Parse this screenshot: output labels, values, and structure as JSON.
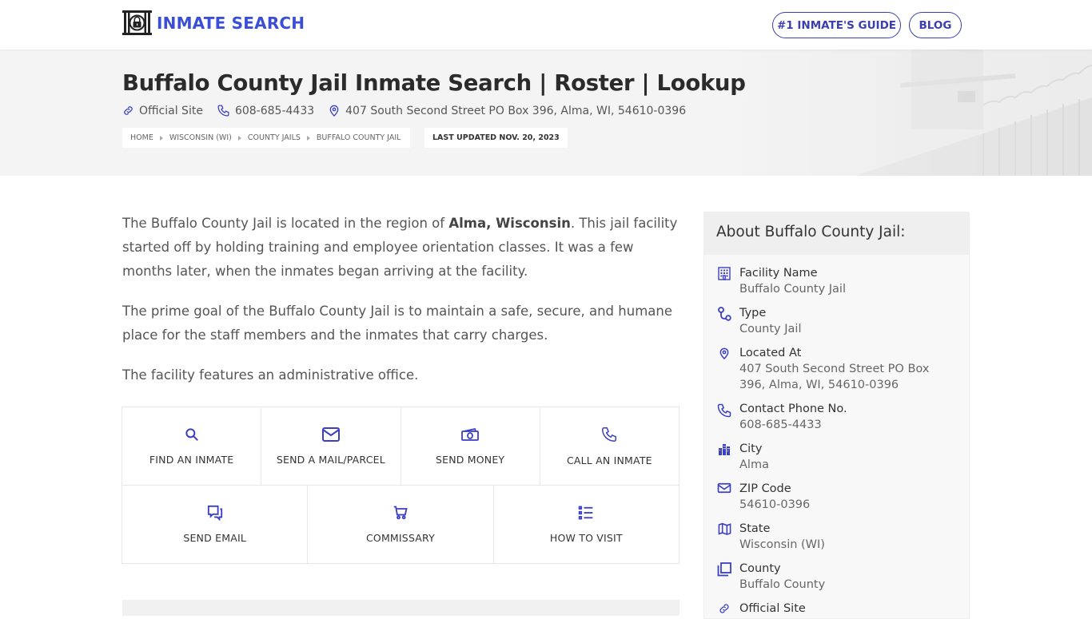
{
  "header": {
    "logo_text": "INMATE SEARCH",
    "nav": [
      {
        "label": "#1 INMATE'S GUIDE"
      },
      {
        "label": "BLOG"
      }
    ]
  },
  "hero": {
    "title": "Buffalo County Jail Inmate Search | Roster | Lookup",
    "meta": {
      "official_site": "Official Site",
      "phone": "608-685-4433",
      "address": "407 South Second Street PO Box 396, Alma, WI, 54610-0396"
    },
    "breadcrumb": [
      {
        "label": "HOME"
      },
      {
        "label": "WISCONSIN (WI)"
      },
      {
        "label": "COUNTY JAILS"
      },
      {
        "label": "BUFFALO COUNTY JAIL"
      }
    ],
    "last_updated": "LAST UPDATED NOV. 20, 2023"
  },
  "content": {
    "p1_before": "The Buffalo County Jail is located in the region of ",
    "p1_bold": "Alma, Wisconsin",
    "p1_after": ". This jail facility started off by holding training and employee orientation classes. It was a few months later, when the inmates began arriving at the facility.",
    "p2": "The prime goal of the Buffalo County Jail is to maintain a safe, secure, and humane place for the staff members and the inmates that carry charges.",
    "p3": "The facility features an administrative office."
  },
  "actions": [
    {
      "label": "FIND AN INMATE",
      "icon": "search-icon"
    },
    {
      "label": "SEND A MAIL/PARCEL",
      "icon": "mail-icon"
    },
    {
      "label": "SEND MONEY",
      "icon": "money-icon"
    },
    {
      "label": "CALL AN INMATE",
      "icon": "phone-icon"
    },
    {
      "label": "SEND EMAIL",
      "icon": "chat-icon"
    },
    {
      "label": "COMMISSARY",
      "icon": "cart-icon"
    },
    {
      "label": "HOW TO VISIT",
      "icon": "list-icon"
    }
  ],
  "sidebar": {
    "title": "About Buffalo County Jail:",
    "items": [
      {
        "label": "Facility Name",
        "value": "Buffalo County Jail",
        "icon": "building-icon"
      },
      {
        "label": "Type",
        "value": "County Jail",
        "icon": "route-icon"
      },
      {
        "label": "Located At",
        "value": "407 South Second Street PO Box 396, Alma, WI, 54610-0396",
        "icon": "location-pin-icon"
      },
      {
        "label": "Contact Phone No.",
        "value": "608-685-4433",
        "icon": "phone-icon"
      },
      {
        "label": "City",
        "value": "Alma",
        "icon": "city-icon"
      },
      {
        "label": "ZIP Code",
        "value": "54610-0396",
        "icon": "mail-icon"
      },
      {
        "label": "State",
        "value": "Wisconsin (WI)",
        "icon": "map-icon"
      },
      {
        "label": "County",
        "value": "Buffalo County",
        "icon": "copy-icon"
      },
      {
        "label": "Official Site",
        "value": "",
        "icon": "link-icon"
      }
    ]
  },
  "colors": {
    "accent": "#3a4fd6",
    "nav_border": "#3b3fae",
    "icon": "#3b3fc4"
  }
}
